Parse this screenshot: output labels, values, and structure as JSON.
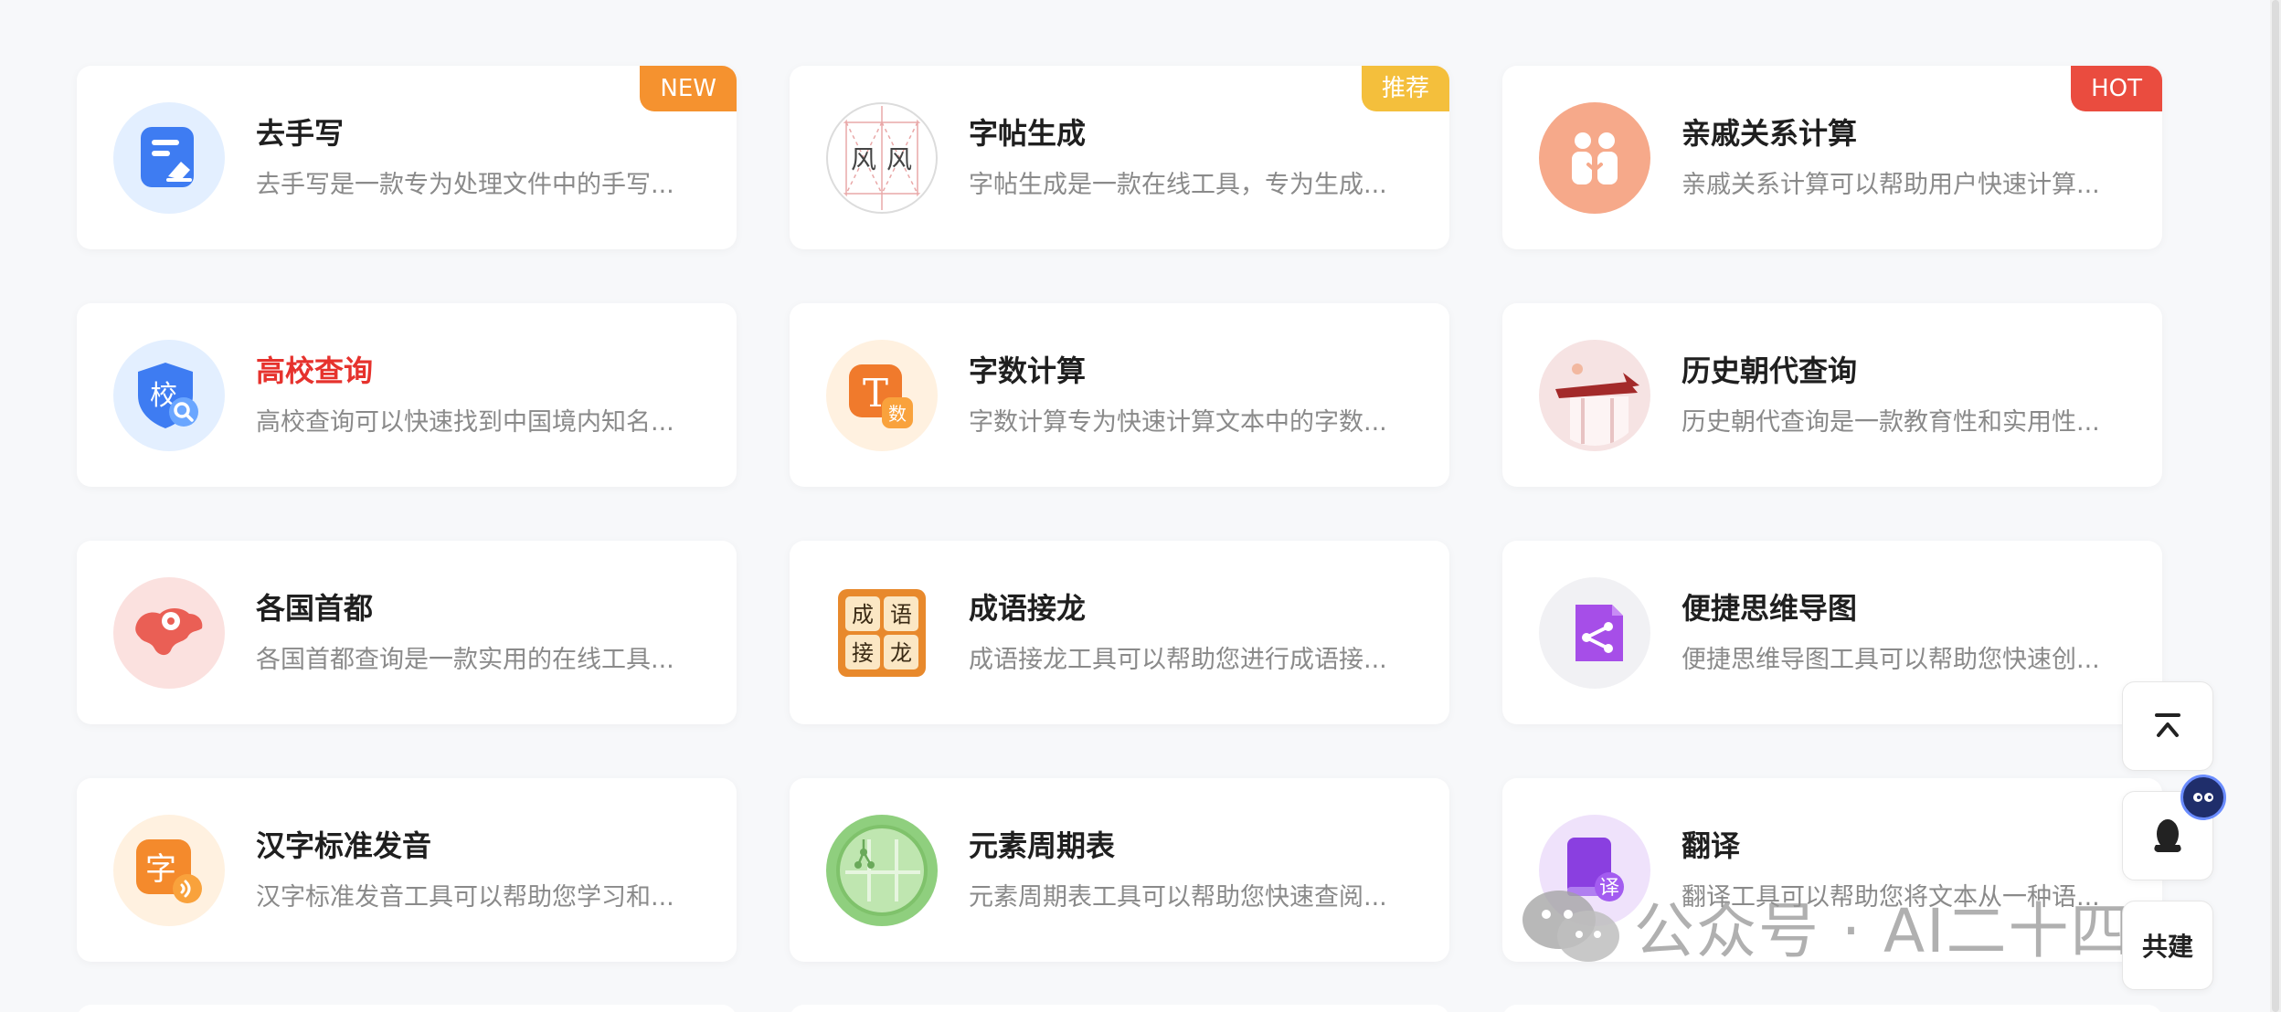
{
  "cards": [
    {
      "title": "去手写",
      "desc": "去手写是一款专为处理文件中的手写...",
      "badge": "NEW",
      "icon": "document-eraser-icon"
    },
    {
      "title": "字帖生成",
      "desc": "字帖生成是一款在线工具，专为生成...",
      "badge": "推荐",
      "icon": "calligraphy-grid-icon",
      "icon_text": "风"
    },
    {
      "title": "亲戚关系计算",
      "desc": "亲戚关系计算可以帮助用户快速计算...",
      "badge": "HOT",
      "icon": "family-relation-icon"
    },
    {
      "title": "高校查询",
      "desc": "高校查询可以快速找到中国境内知名...",
      "badge": "",
      "icon": "school-shield-search-icon",
      "icon_text": "校"
    },
    {
      "title": "字数计算",
      "desc": "字数计算专为快速计算文本中的字数...",
      "badge": "",
      "icon": "word-count-icon",
      "icon_text": "T",
      "icon_sub": "数"
    },
    {
      "title": "历史朝代查询",
      "desc": "历史朝代查询是一款教育性和实用性...",
      "badge": "",
      "icon": "ancient-building-icon"
    },
    {
      "title": "各国首都",
      "desc": "各国首都查询是一款实用的在线工具...",
      "badge": "",
      "icon": "world-map-pin-icon"
    },
    {
      "title": "成语接龙",
      "desc": "成语接龙工具可以帮助您进行成语接...",
      "badge": "",
      "icon": "idiom-tiles-icon",
      "icon_tiles": [
        "成",
        "语",
        "接",
        "龙"
      ]
    },
    {
      "title": "便捷思维导图",
      "desc": "便捷思维导图工具可以帮助您快速创...",
      "badge": "",
      "icon": "mind-map-icon"
    },
    {
      "title": "汉字标准发音",
      "desc": "汉字标准发音工具可以帮助您学习和...",
      "badge": "",
      "icon": "character-pronunciation-icon",
      "icon_text": "字"
    },
    {
      "title": "元素周期表",
      "desc": "元素周期表工具可以帮助您快速查阅...",
      "badge": "",
      "icon": "periodic-table-icon"
    },
    {
      "title": "翻译",
      "desc": "翻译工具可以帮助您将文本从一种语...",
      "badge": "",
      "icon": "translate-book-icon",
      "icon_text": "译"
    }
  ],
  "sidebar": {
    "back_to_top": "back-to-top-icon",
    "qq": "qq-penguin-icon",
    "co_build_label": "共建"
  },
  "watermark": {
    "text": "公众号 · AI二十四时",
    "icon": "wechat-icon"
  },
  "colors": {
    "red_title": "#e6322d",
    "badge_new": "#f5922f",
    "badge_recommend": "#f4bf3c",
    "badge_hot": "#ea4c3f"
  }
}
